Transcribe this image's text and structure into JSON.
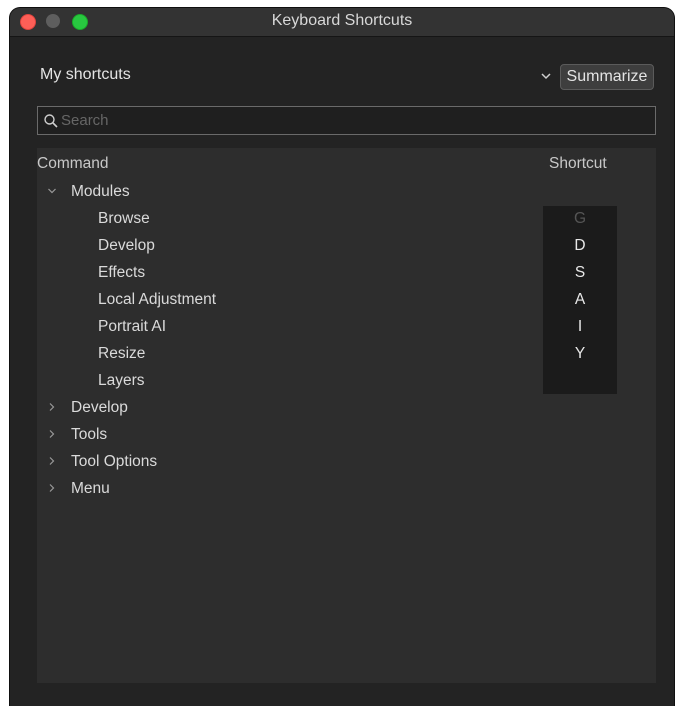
{
  "window": {
    "title": "Keyboard Shortcuts"
  },
  "preset": {
    "label": "My shortcuts"
  },
  "summarize_label": "Summarize",
  "search": {
    "placeholder": "Search"
  },
  "columns": {
    "command": "Command",
    "shortcut": "Shortcut"
  },
  "tree": {
    "modules": {
      "label": "Modules",
      "items": [
        {
          "label": "Browse",
          "shortcut": "G"
        },
        {
          "label": "Develop",
          "shortcut": "D"
        },
        {
          "label": "Effects",
          "shortcut": "S"
        },
        {
          "label": "Local Adjustment",
          "shortcut": "A"
        },
        {
          "label": "Portrait AI",
          "shortcut": "I"
        },
        {
          "label": "Resize",
          "shortcut": "Y"
        },
        {
          "label": "Layers",
          "shortcut": ""
        }
      ]
    },
    "groups": [
      {
        "label": "Develop"
      },
      {
        "label": "Tools"
      },
      {
        "label": "Tool Options"
      },
      {
        "label": "Menu"
      }
    ]
  }
}
